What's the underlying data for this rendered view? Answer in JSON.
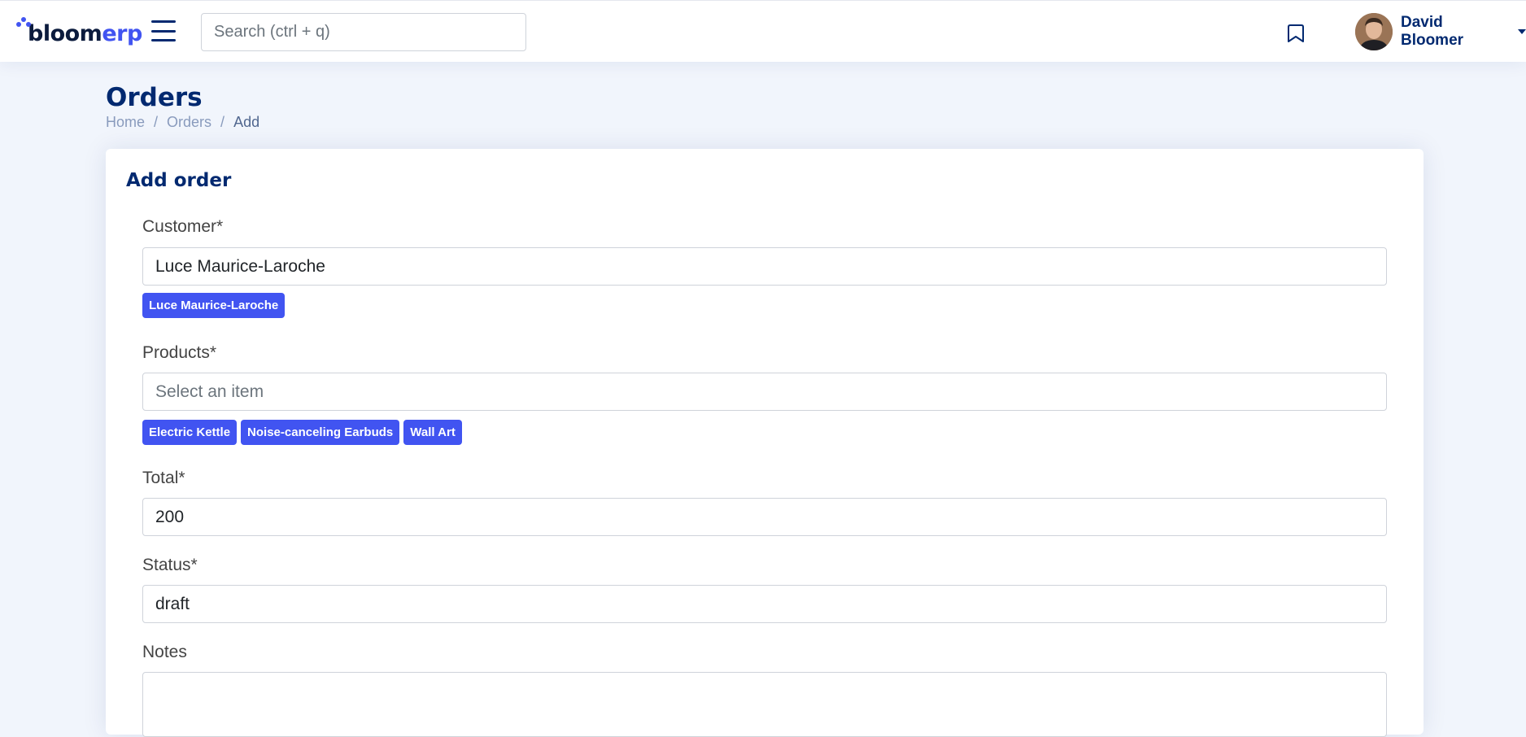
{
  "brand": {
    "name_part1": "bloom",
    "name_part2": "erp"
  },
  "header": {
    "search_placeholder": "Search (ctrl + q)",
    "user_name": "David Bloomer"
  },
  "page": {
    "title": "Orders",
    "breadcrumb": [
      "Home",
      "Orders",
      "Add"
    ]
  },
  "form": {
    "title": "Add order",
    "customer": {
      "label": "Customer*",
      "value": "Luce Maurice-Laroche",
      "selected": [
        "Luce Maurice-Laroche"
      ]
    },
    "products": {
      "label": "Products*",
      "placeholder": "Select an item",
      "selected": [
        "Electric Kettle",
        "Noise-canceling Earbuds",
        "Wall Art"
      ]
    },
    "total": {
      "label": "Total*",
      "value": "200"
    },
    "status": {
      "label": "Status*",
      "value": "draft"
    },
    "notes": {
      "label": "Notes",
      "value": ""
    }
  },
  "colors": {
    "accent": "#4154f1",
    "navy": "#012970",
    "background": "#f1f5fc"
  }
}
